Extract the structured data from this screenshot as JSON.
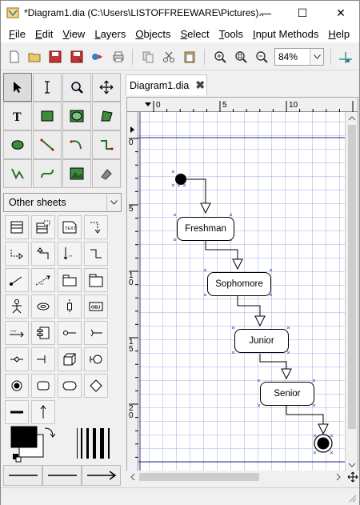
{
  "window": {
    "title": "*Diagram1.dia (C:\\Users\\LISTOFFREEWARE\\Pictures)...",
    "minimize": "—",
    "maximize": "☐",
    "close": "✕"
  },
  "menu": [
    {
      "label": "File"
    },
    {
      "label": "Edit"
    },
    {
      "label": "View"
    },
    {
      "label": "Layers"
    },
    {
      "label": "Objects"
    },
    {
      "label": "Select"
    },
    {
      "label": "Tools"
    },
    {
      "label": "Input Methods"
    },
    {
      "label": "Help"
    }
  ],
  "toolbar": {
    "icons": [
      "new-icon",
      "open-icon",
      "save-icon",
      "save-as-icon",
      "export-icon",
      "print-icon",
      "copy-icon",
      "cut-icon",
      "paste-icon",
      "zoom-in-icon",
      "zoom-fit-icon",
      "zoom-out-icon"
    ],
    "zoom_value": "84%"
  },
  "toolbox": {
    "tools": [
      "pointer",
      "text-edit",
      "magnify",
      "move",
      "text",
      "box",
      "ellipse",
      "polygon",
      "beziergon",
      "line",
      "arc",
      "zigzag-line",
      "polyline",
      "bezier-line",
      "image",
      "outline"
    ],
    "sheet": "Other sheets",
    "shapes": [
      "uml-class",
      "uml-class-template",
      "uml-note",
      "uml-dependency",
      "uml-realizes",
      "uml-generalization",
      "uml-association",
      "uml-implements",
      "uml-constraint",
      "uml-small-package",
      "uml-large-package",
      "uml-actor",
      "uml-usecase",
      "uml-lifeline",
      "uml-object",
      "uml-message",
      "uml-component",
      "uml-classicon",
      "uml-component-feature",
      "uml-node",
      "uml-branch",
      "uml-fork",
      "uml-state-term",
      "uml-state",
      "uml-activity",
      "uml-transition",
      "uml-note-link",
      "uml-arrow-up"
    ]
  },
  "tab": {
    "label": "Diagram1.dia",
    "close": "✖"
  },
  "rulers": {
    "h_ticks": [
      "0",
      "5",
      "10"
    ],
    "v_ticks": [
      "0",
      "5",
      "1\n0",
      "1\n5",
      "2\n0"
    ]
  },
  "diagram": {
    "states": [
      {
        "label": "Freshman"
      },
      {
        "label": "Sophomore"
      },
      {
        "label": "Junior"
      },
      {
        "label": "Senior"
      }
    ]
  }
}
